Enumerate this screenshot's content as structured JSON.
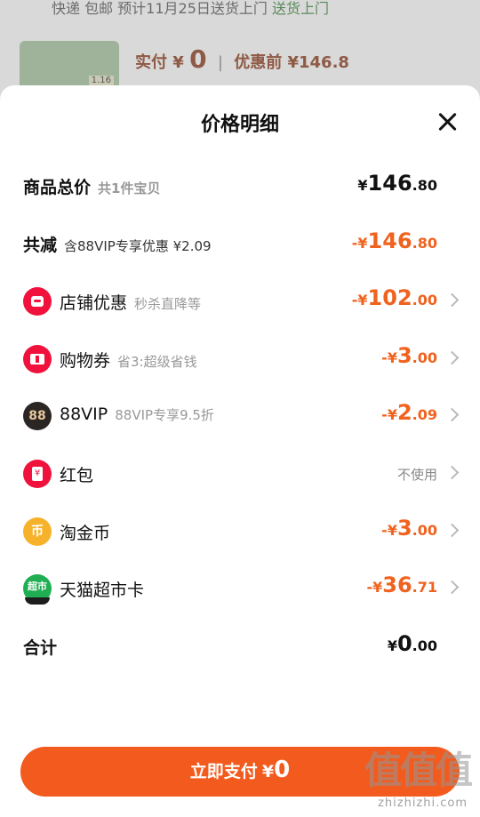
{
  "background": {
    "delivery_text": "快递 包邮 预计11月25日送货上门",
    "delivery_tag": "送货上门",
    "thumb_tag": "1.16",
    "pay_label": "实付",
    "pay_currency": "¥",
    "pay_amount": "0",
    "original_label": "优惠前 ¥146.8"
  },
  "sheet": {
    "title": "价格明细",
    "rows": [
      {
        "label": "商品总价",
        "sub": "共1件宝贝",
        "currency": "¥",
        "int": "146",
        "dec": ".80"
      },
      {
        "label": "共减",
        "sub": "含88VIP专享优惠 ¥2.09",
        "currency": "-¥",
        "int": "146",
        "dec": ".80"
      },
      {
        "label": "店铺优惠",
        "sub": "秒杀直降等",
        "icon": "store-icon",
        "currency": "-¥",
        "int": "102",
        "dec": ".00"
      },
      {
        "label": "购物券",
        "sub": "省3:超级省钱",
        "icon": "coupon-icon",
        "currency": "-¥",
        "int": "3",
        "dec": ".00"
      },
      {
        "label": "88VIP",
        "sub": "88VIP专享9.5折",
        "icon": "88vip-icon",
        "icon_text": "88",
        "currency": "-¥",
        "int": "2",
        "dec": ".09"
      },
      {
        "label": "红包",
        "icon": "red-packet-icon",
        "value_text": "不使用"
      },
      {
        "label": "淘金币",
        "icon": "gold-coin-icon",
        "icon_text": "币",
        "currency": "-¥",
        "int": "3",
        "dec": ".00"
      },
      {
        "label": "天猫超市卡",
        "icon": "supermarket-card-icon",
        "icon_text": "超市",
        "currency": "-¥",
        "int": "36",
        "dec": ".71"
      },
      {
        "label": "合计",
        "currency": "¥",
        "int": "0",
        "dec": ".00"
      }
    ],
    "pay_button": {
      "label": "立即支付",
      "currency": "¥",
      "amount": "0"
    }
  },
  "watermark": {
    "logo": "值值值",
    "url": "zhizhizhi.com"
  },
  "colors": {
    "accent": "#f0621e",
    "button": "#f25b1d",
    "icon_red": "#f0123c"
  }
}
